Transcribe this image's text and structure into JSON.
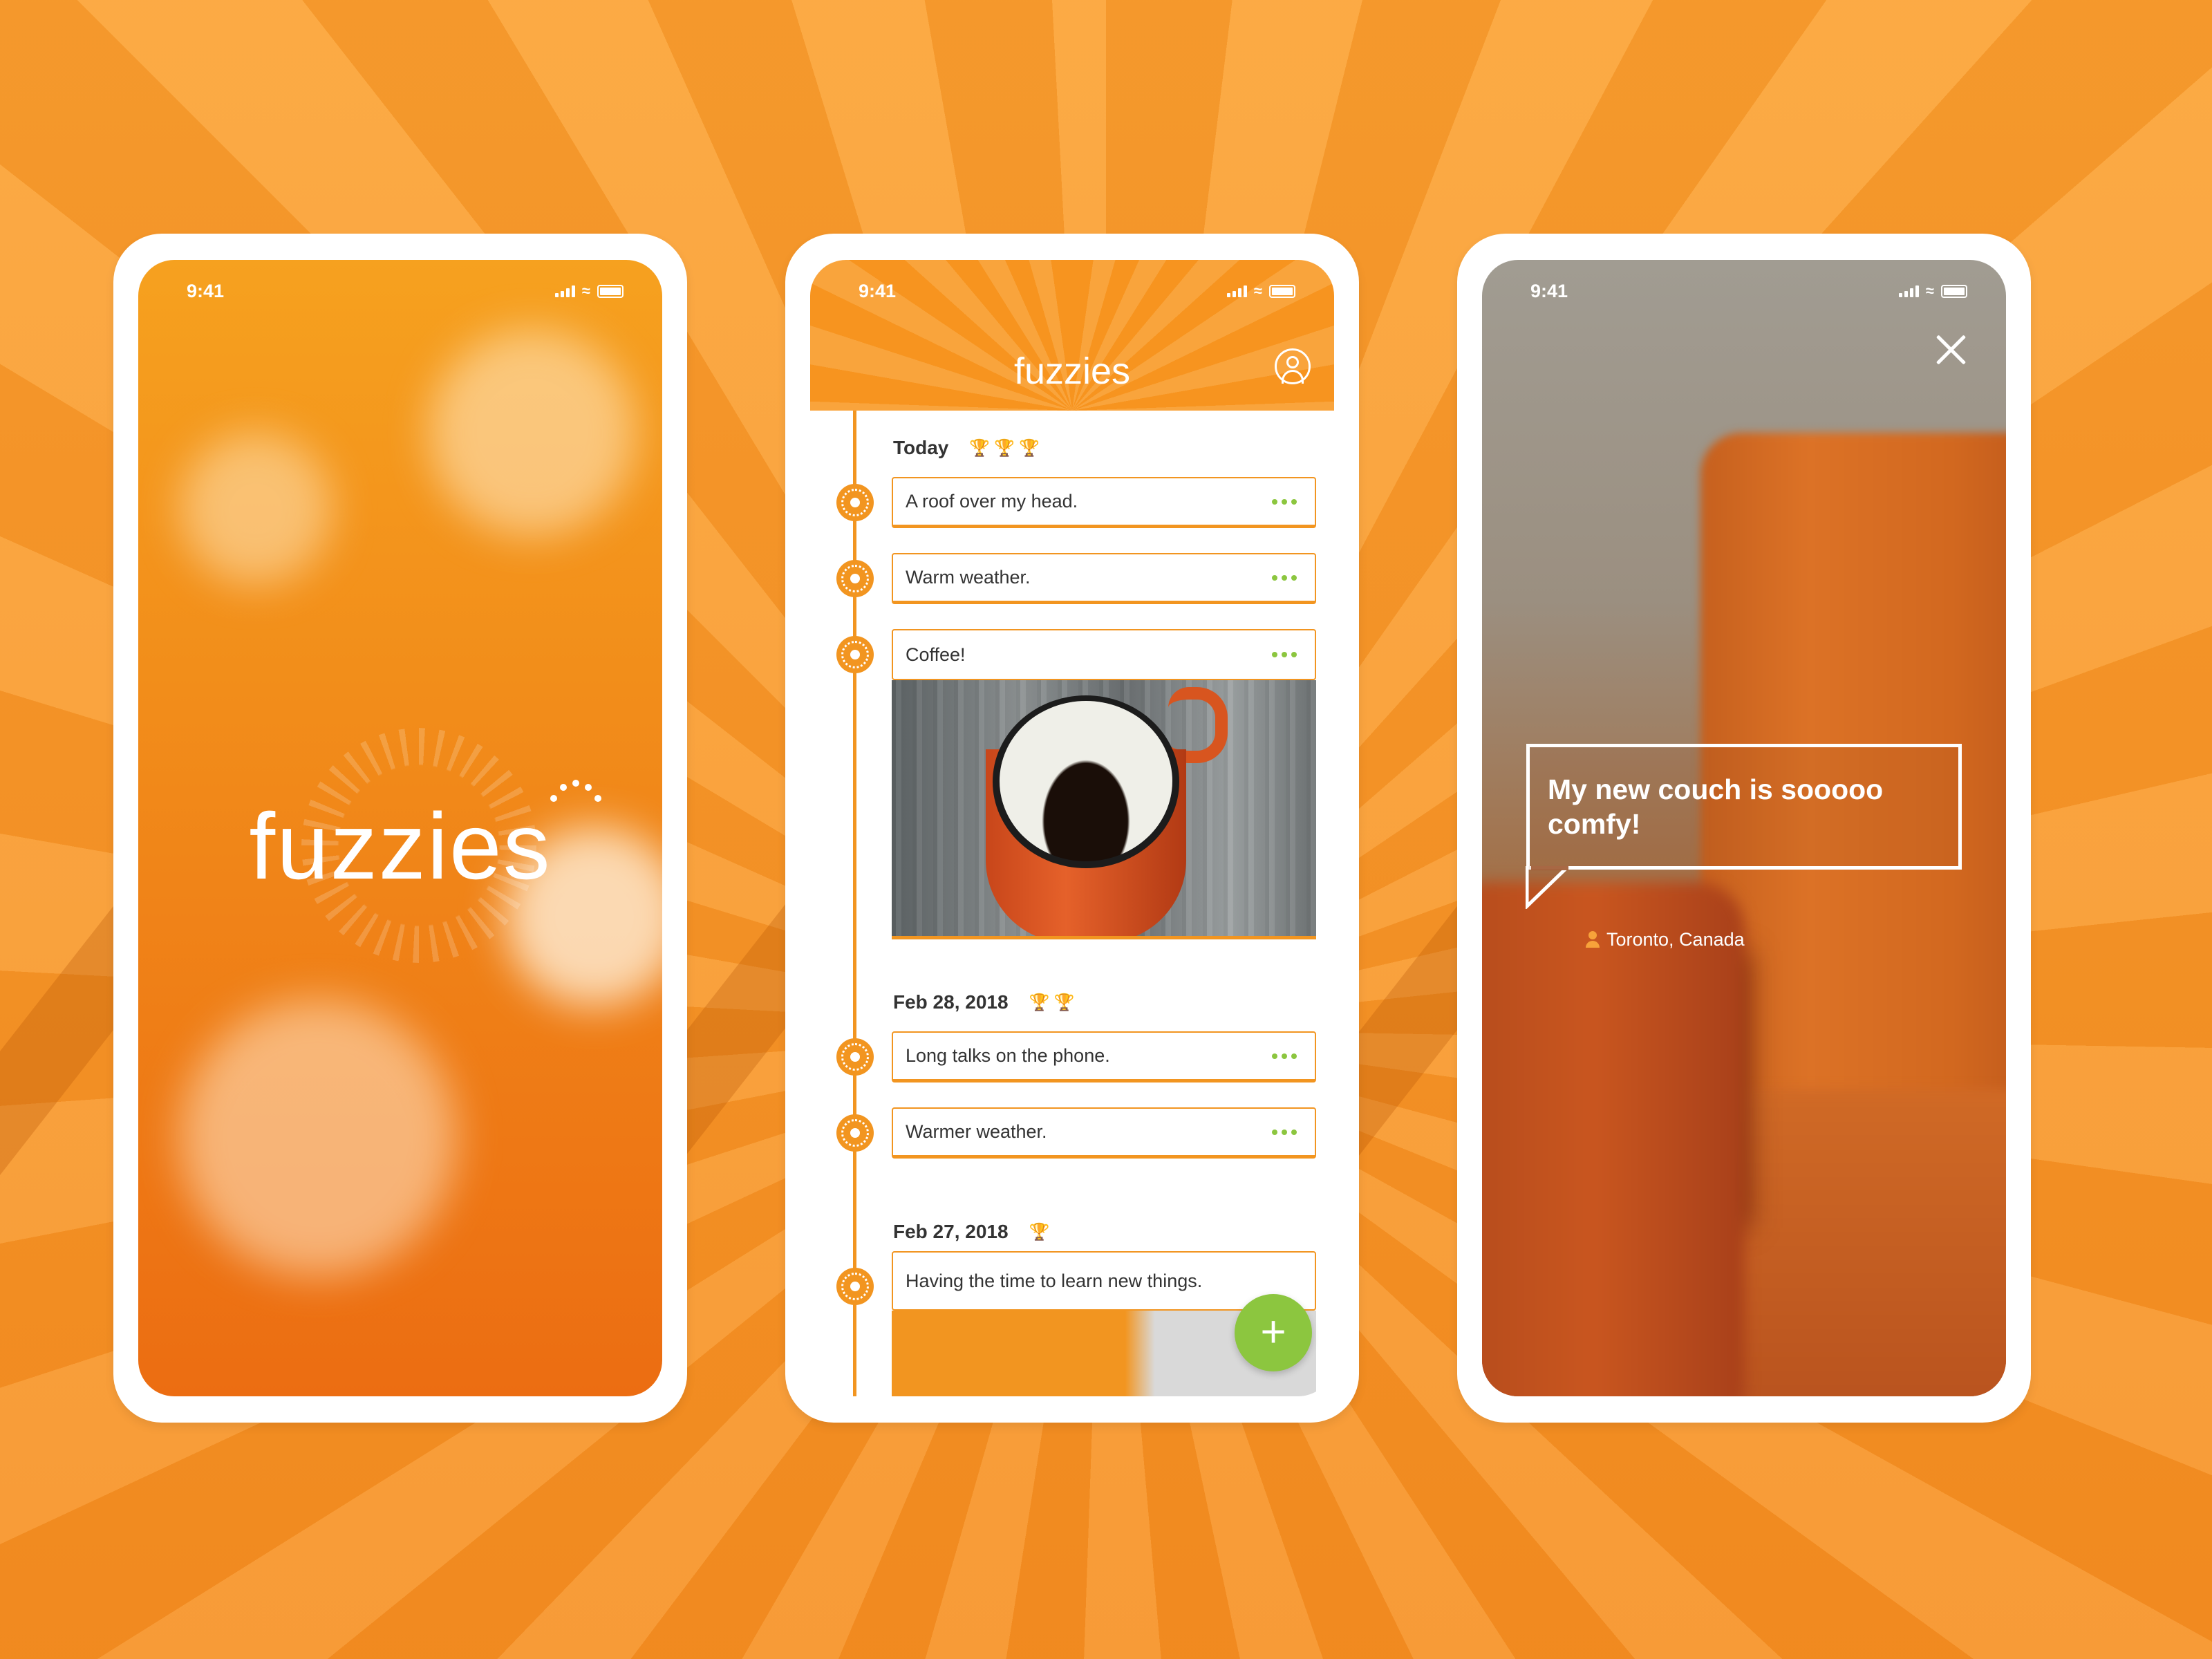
{
  "status": {
    "time": "9:41"
  },
  "screen1": {
    "logo": "fuzzies"
  },
  "screen2": {
    "header_logo": "fuzzies",
    "groups": [
      {
        "date": "Today",
        "trophies": 3,
        "entries": [
          "A roof over my head.",
          "Warm weather.",
          "Coffee!"
        ]
      },
      {
        "date": "Feb 28, 2018",
        "trophies": 2,
        "entries": [
          "Long talks on the phone.",
          "Warmer weather."
        ]
      },
      {
        "date": "Feb 27, 2018",
        "trophies": 1,
        "entries": [
          "Having the time to learn new things."
        ]
      }
    ],
    "fab_label": "+"
  },
  "screen3": {
    "caption": "My new couch is sooooo comfy!",
    "location": "Toronto, Canada"
  },
  "colors": {
    "primary_orange": "#f29520",
    "accent_green": "#8cc63f",
    "trophy_gold": "#f4b51b"
  }
}
